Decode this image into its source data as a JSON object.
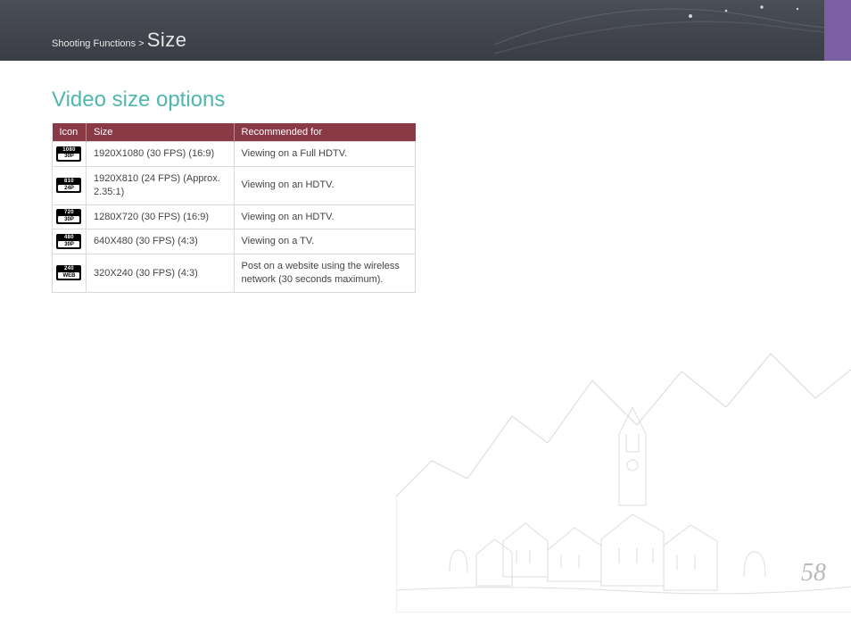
{
  "breadcrumb": {
    "section": "Shooting Functions",
    "sep": ">",
    "title": "Size"
  },
  "heading": "Video size options",
  "table": {
    "headers": {
      "icon": "Icon",
      "size": "Size",
      "recommended": "Recommended for"
    },
    "rows": [
      {
        "icon_top": "1080",
        "icon_bot": "30P",
        "size": "1920X1080 (30 FPS) (16:9)",
        "recommended": "Viewing on a Full HDTV."
      },
      {
        "icon_top": "810",
        "icon_bot": "24P",
        "size": "1920X810 (24 FPS) (Approx. 2.35:1)",
        "recommended": "Viewing on an HDTV."
      },
      {
        "icon_top": "720",
        "icon_bot": "30P",
        "size": "1280X720 (30 FPS) (16:9)",
        "recommended": "Viewing on an HDTV."
      },
      {
        "icon_top": "480",
        "icon_bot": "30P",
        "size": "640X480 (30 FPS) (4:3)",
        "recommended": "Viewing on a TV."
      },
      {
        "icon_top": "240",
        "icon_bot": "WEB",
        "size": "320X240 (30 FPS) (4:3)",
        "recommended": "Post on a website using the wireless network (30 seconds maximum)."
      }
    ]
  },
  "page_number": "58"
}
